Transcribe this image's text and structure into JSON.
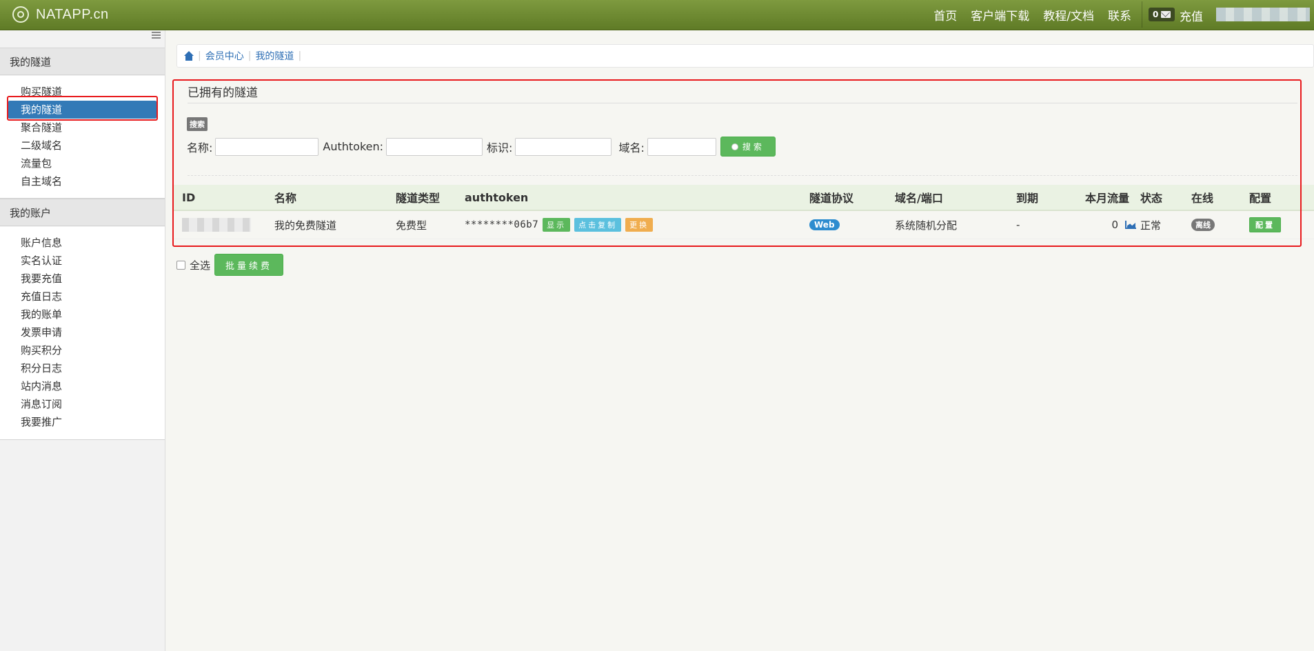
{
  "brand": {
    "name": "NATAPP.cn"
  },
  "topnav": {
    "links": [
      "首页",
      "客户端下载",
      "教程/文档",
      "联系"
    ],
    "message_count": "0",
    "recharge": "充值"
  },
  "sidebar": {
    "group1_title": "我的隧道",
    "group1_items": [
      "购买隧道",
      "我的隧道",
      "聚合隧道",
      "二级域名",
      "流量包",
      "自主域名"
    ],
    "group2_title": "我的账户",
    "group2_items": [
      "账户信息",
      "实名认证",
      "我要充值",
      "充值日志",
      "我的账单",
      "发票申请",
      "购买积分",
      "积分日志",
      "站内消息",
      "消息订阅",
      "我要推广"
    ]
  },
  "breadcrumb": [
    "会员中心",
    "我的隧道"
  ],
  "panel": {
    "title": "已拥有的隧道",
    "search_tag": "搜索",
    "search_fields": [
      {
        "label": "名称:",
        "value": ""
      },
      {
        "label": "Authtoken:",
        "value": ""
      },
      {
        "label": "标识:",
        "value": ""
      },
      {
        "label": "域名:",
        "value": ""
      }
    ],
    "search_button": "搜索"
  },
  "table": {
    "headers": [
      "ID",
      "名称",
      "隧道类型",
      "authtoken",
      "隧道协议",
      "域名/端口",
      "到期",
      "本月流量",
      "状态",
      "在线",
      "配置"
    ],
    "rows": [
      {
        "name": "我的免费隧道",
        "type": "免费型",
        "authtoken": "********06b7",
        "btn_show": "显示",
        "btn_copy": "点击复制",
        "btn_change": "更换",
        "protocol": "Web",
        "domain": "系统随机分配",
        "expire": "-",
        "traffic": "0",
        "status": "正常",
        "online": "离线",
        "config": "配置"
      }
    ]
  },
  "batch": {
    "select_all": "全选",
    "button": "批量续费"
  },
  "colors": {
    "navbar": "#6b8630",
    "highlight_red": "#e8191c",
    "active_blue": "#337ab7",
    "btn_green": "#5cb85c"
  }
}
